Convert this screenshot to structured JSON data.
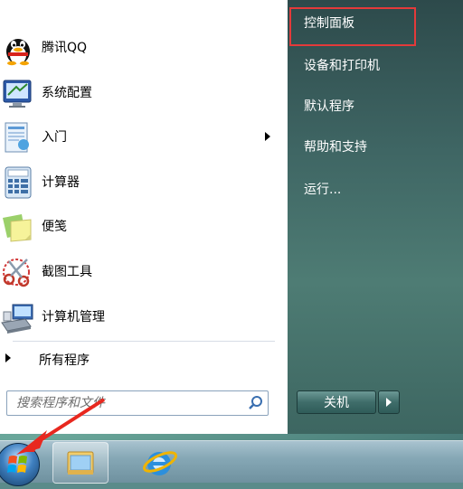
{
  "left_programs": [
    {
      "label": "腾讯QQ",
      "icon": "qq-penguin-icon"
    },
    {
      "label": "系统配置",
      "icon": "system-config-icon"
    },
    {
      "label": "入门",
      "icon": "getting-started-icon"
    },
    {
      "label": "计算器",
      "icon": "calculator-icon"
    },
    {
      "label": "便笺",
      "icon": "sticky-notes-icon"
    },
    {
      "label": "截图工具",
      "icon": "snipping-tool-icon"
    },
    {
      "label": "计算机管理",
      "icon": "computer-management-icon"
    }
  ],
  "all_programs_label": "所有程序",
  "search": {
    "placeholder": "搜索程序和文件"
  },
  "right_items": [
    {
      "label": "控制面板"
    },
    {
      "label": "设备和打印机"
    },
    {
      "label": "默认程序"
    },
    {
      "label": "帮助和支持"
    },
    {
      "label": "运行..."
    }
  ],
  "shutdown_label": "关机",
  "colors": {
    "highlight_border": "#e43a3a",
    "annotation_arrow": "#e8281f"
  },
  "taskbar": {
    "buttons": [
      "start-orb-icon",
      "windows-explorer-icon",
      "internet-explorer-icon"
    ]
  }
}
